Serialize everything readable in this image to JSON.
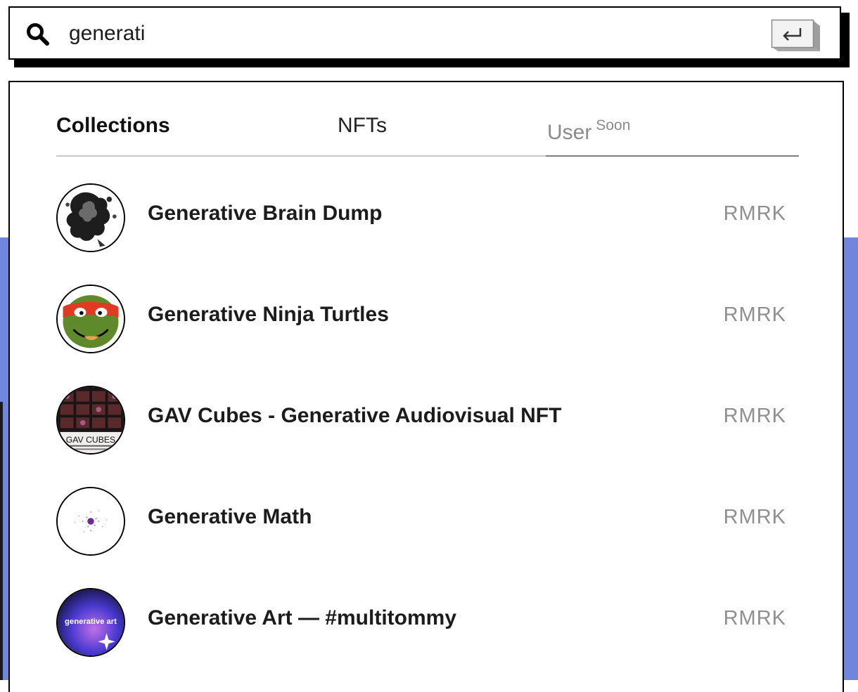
{
  "search": {
    "value": "generati",
    "icon": "search-icon",
    "enter_icon": "enter-key-icon"
  },
  "tabs": [
    {
      "label": "Collections",
      "active": true
    },
    {
      "label": "NFTs",
      "active": false
    },
    {
      "label": "User",
      "badge": "Soon",
      "disabled": true
    }
  ],
  "results": [
    {
      "name": "Generative Brain Dump",
      "chain": "RMRK",
      "avatar": "ink-splash-avatar"
    },
    {
      "name": "Generative Ninja Turtles",
      "chain": "RMRK",
      "avatar": "turtle-avatar"
    },
    {
      "name": "GAV Cubes - Generative Audiovisual NFT",
      "chain": "RMRK",
      "avatar": "gav-cubes-avatar",
      "avatar_text": "GAV CUBES"
    },
    {
      "name": "Generative Math",
      "chain": "RMRK",
      "avatar": "math-dots-avatar"
    },
    {
      "name": "Generative Art — #multitommy",
      "chain": "RMRK",
      "avatar": "generative-art-avatar",
      "avatar_text": "generative art"
    }
  ],
  "colors": {
    "page_accent": "#6f86dc",
    "muted_text": "#8f8f8f",
    "border": "#000000"
  }
}
